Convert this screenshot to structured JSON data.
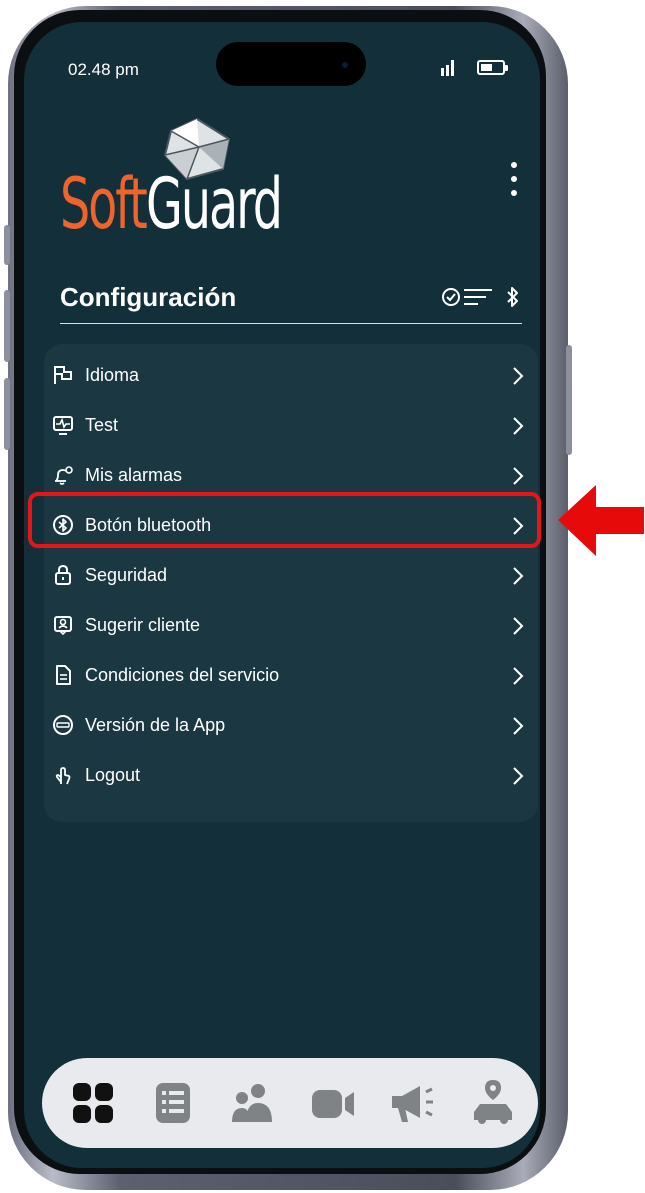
{
  "status": {
    "time": "02.48 pm"
  },
  "logo": {
    "soft": "Soft",
    "guard": "Guard"
  },
  "page": {
    "title": "Configuración"
  },
  "menu": {
    "items": [
      {
        "label": "Idioma",
        "icon": "flag-icon"
      },
      {
        "label": "Test",
        "icon": "monitor-pulse-icon"
      },
      {
        "label": "Mis alarmas",
        "icon": "bell-settings-icon"
      },
      {
        "label": "Botón bluetooth",
        "icon": "bluetooth-circle-icon"
      },
      {
        "label": "Seguridad",
        "icon": "lock-icon"
      },
      {
        "label": "Sugerir cliente",
        "icon": "user-badge-icon"
      },
      {
        "label": "Condiciones del servicio",
        "icon": "document-icon"
      },
      {
        "label": "Versión de la App",
        "icon": "sos-icon"
      },
      {
        "label": "Logout",
        "icon": "hand-pointer-icon"
      }
    ]
  },
  "highlighted_item": "Botón bluetooth",
  "bottom_nav": {
    "items": [
      {
        "icon": "grid-icon",
        "active": true
      },
      {
        "icon": "list-icon",
        "active": false
      },
      {
        "icon": "users-icon",
        "active": false
      },
      {
        "icon": "video-camera-icon",
        "active": false
      },
      {
        "icon": "megaphone-icon",
        "active": false
      },
      {
        "icon": "car-location-icon",
        "active": false
      }
    ]
  },
  "colors": {
    "screen_bg": "#132f3a",
    "card_bg": "#1b3742",
    "brand_orange": "#f0642b",
    "highlight_red": "#e61616",
    "nav_bg": "#e9eaed",
    "nav_active": "#111111",
    "nav_inactive": "#808386"
  }
}
